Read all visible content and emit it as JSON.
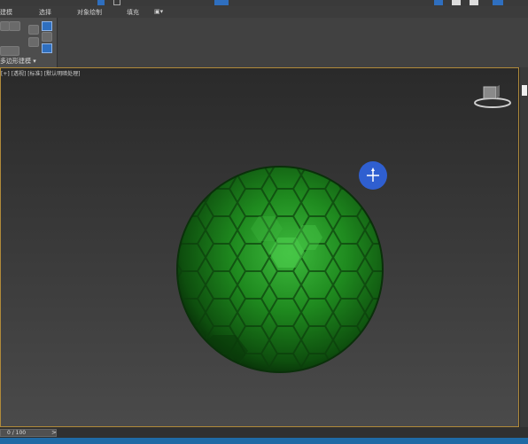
{
  "tabs": [
    {
      "label": "建模"
    },
    {
      "label": "选择"
    },
    {
      "label": "对象绘制"
    },
    {
      "label": "填充"
    }
  ],
  "ribbon": {
    "footer_label": "多边形建模 ▾"
  },
  "viewport": {
    "label": "[+] [透视] [标准] [默认明暗处理]"
  },
  "timeline": {
    "frame_label": "0 / 100",
    "next_label": ">"
  },
  "colors": {
    "accent": "#2f5fd0",
    "sphere": "#1f7a1f",
    "viewport_border": "#b08a3a",
    "track": "#1f6aa5"
  },
  "icons": [
    "axis-gizmo-icon",
    "viewcube-icon",
    "visibility-icon",
    "cursor-icon"
  ]
}
